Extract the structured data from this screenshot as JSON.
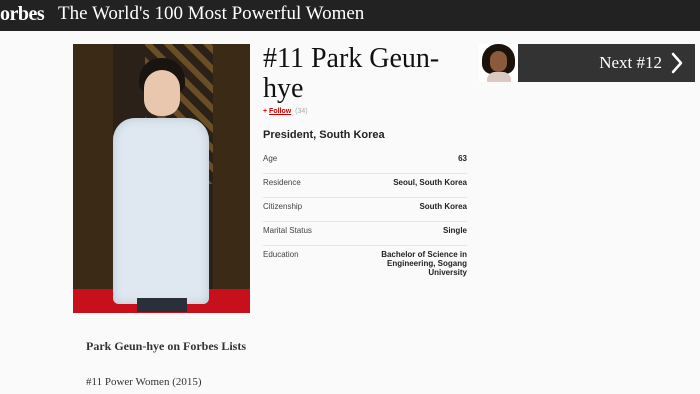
{
  "header": {
    "logo": "orbes",
    "list_title": "The World's 100 Most Powerful Women"
  },
  "profile": {
    "title": "#11 Park Geun-hye",
    "follow_label": "Follow",
    "follow_count": "(34)",
    "role": "President, South Korea",
    "facts": [
      {
        "label": "Age",
        "value": "63"
      },
      {
        "label": "Residence",
        "value": "Seoul, South Korea"
      },
      {
        "label": "Citizenship",
        "value": "South Korea"
      },
      {
        "label": "Marital Status",
        "value": "Single"
      },
      {
        "label": "Education",
        "value": "Bachelor of Science in Engineering, Sogang University"
      }
    ]
  },
  "next": {
    "label": "Next #12",
    "icon": "chevron-right-icon"
  },
  "forbes_lists": {
    "heading": "Park Geun-hye on Forbes Lists",
    "items": [
      "#11 Power Women (2015)"
    ]
  },
  "colors": {
    "topbar": "#222222",
    "next_button": "#333333",
    "follow": "#cc0000"
  }
}
